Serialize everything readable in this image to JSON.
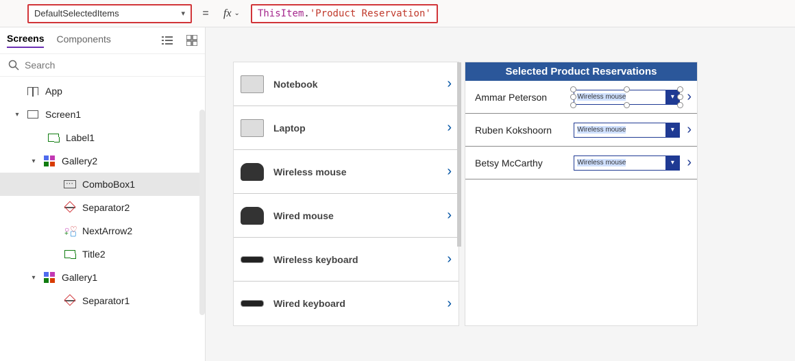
{
  "formula": {
    "property": "DefaultSelectedItems",
    "equals": "=",
    "fx_label": "fx",
    "token_this": "ThisItem",
    "token_dot": ".",
    "token_field": "'Product Reservation'"
  },
  "left_panel": {
    "tabs": {
      "screens": "Screens",
      "components": "Components"
    },
    "search_placeholder": "Search",
    "tree": {
      "app": "App",
      "screen1": "Screen1",
      "label1": "Label1",
      "gallery2": "Gallery2",
      "combobox1": "ComboBox1",
      "separator2": "Separator2",
      "nextarrow2": "NextArrow2",
      "title2": "Title2",
      "gallery1": "Gallery1",
      "separator1": "Separator1"
    }
  },
  "canvas": {
    "products": [
      {
        "name": "Notebook",
        "thumb": "laptop"
      },
      {
        "name": "Laptop",
        "thumb": "laptop"
      },
      {
        "name": "Wireless mouse",
        "thumb": "dark"
      },
      {
        "name": "Wired mouse",
        "thumb": "dark"
      },
      {
        "name": "Wireless keyboard",
        "thumb": "flat"
      },
      {
        "name": "Wired keyboard",
        "thumb": "flat"
      }
    ],
    "reservations_header": "Selected Product Reservations",
    "reservations": [
      {
        "name": "Ammar Peterson",
        "value": "Wireless mouse",
        "selected": true
      },
      {
        "name": "Ruben Kokshoorn",
        "value": "Wireless mouse",
        "selected": false
      },
      {
        "name": "Betsy McCarthy",
        "value": "Wireless mouse",
        "selected": false
      }
    ]
  }
}
